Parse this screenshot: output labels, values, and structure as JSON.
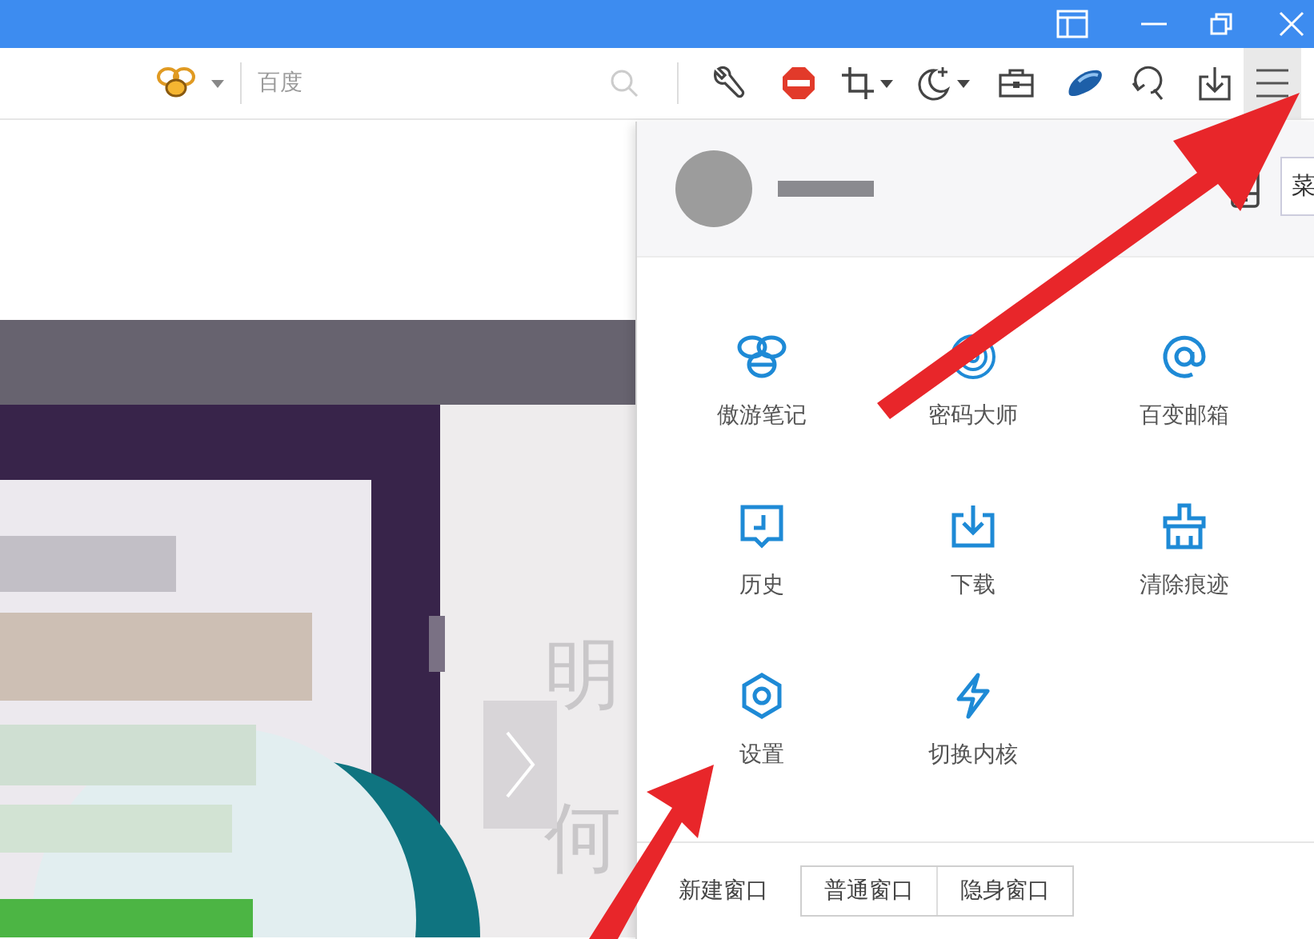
{
  "toolbar": {
    "search": {
      "placeholder": "百度"
    }
  },
  "page": {
    "texts": [
      "明",
      "何"
    ]
  },
  "menu": {
    "tooltip": "菜",
    "items": [
      {
        "label": "傲游笔记"
      },
      {
        "label": "密码大师"
      },
      {
        "label": "百变邮箱"
      },
      {
        "label": "历史"
      },
      {
        "label": "下载"
      },
      {
        "label": "清除痕迹"
      },
      {
        "label": "设置"
      },
      {
        "label": "切换内核"
      }
    ],
    "new_window": {
      "label": "新建窗口",
      "buttons": [
        "普通窗口",
        "隐身窗口"
      ]
    }
  }
}
